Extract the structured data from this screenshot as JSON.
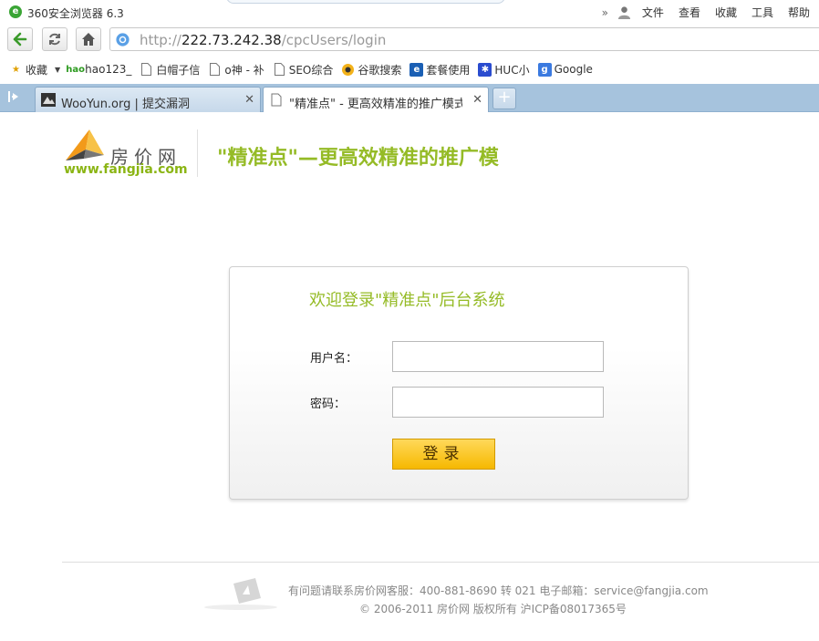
{
  "window": {
    "app_title": "360安全浏览器 6.3",
    "menu": [
      "文件",
      "查看",
      "收藏",
      "工具",
      "帮助"
    ]
  },
  "nav": {
    "url_prefix": "http://",
    "url_host": "222.73.242.38",
    "url_path": "/cpcUsers/login"
  },
  "bookmarks": [
    {
      "label": "收藏",
      "icon": "star-folder-icon"
    },
    {
      "label": "hao123_",
      "icon": "hao-icon"
    },
    {
      "label": "白帽子信",
      "icon": "page-icon"
    },
    {
      "label": "o神 - 补",
      "icon": "page-icon"
    },
    {
      "label": "SEO综合",
      "icon": "page-icon"
    },
    {
      "label": "谷歌搜索",
      "icon": "google-search-icon"
    },
    {
      "label": "套餐使用",
      "icon": "telecom-icon"
    },
    {
      "label": "HUC小",
      "icon": "paw-icon"
    },
    {
      "label": "Google",
      "icon": "google-g-icon"
    }
  ],
  "tabs": [
    {
      "label": "WooYun.org | 提交漏洞",
      "active": false
    },
    {
      "label": "\"精准点\" - 更高效精准的推广模式 - 房",
      "active": true
    }
  ],
  "page": {
    "logo_cn": "房价网",
    "logo_url": "www.fangjia.com",
    "slogan": "\"精准点\"—更高效精准的推广模",
    "login": {
      "title": "欢迎登录\"精准点\"后台系统",
      "username_label": "用户名：",
      "password_label": "密码：",
      "username_value": "",
      "password_value": "",
      "submit_label": "登录"
    },
    "footer": {
      "line1": "有问题请联系房价网客服：400-881-8690 转  021 电子邮箱：service@fangjia.com",
      "line2": "© 2006-2011 房价网  版权所有  沪ICP备08017365号"
    }
  },
  "colors": {
    "accent_green": "#95bb26",
    "tab_strip": "#a6c3dd",
    "button_yellow": "#f6b800"
  }
}
